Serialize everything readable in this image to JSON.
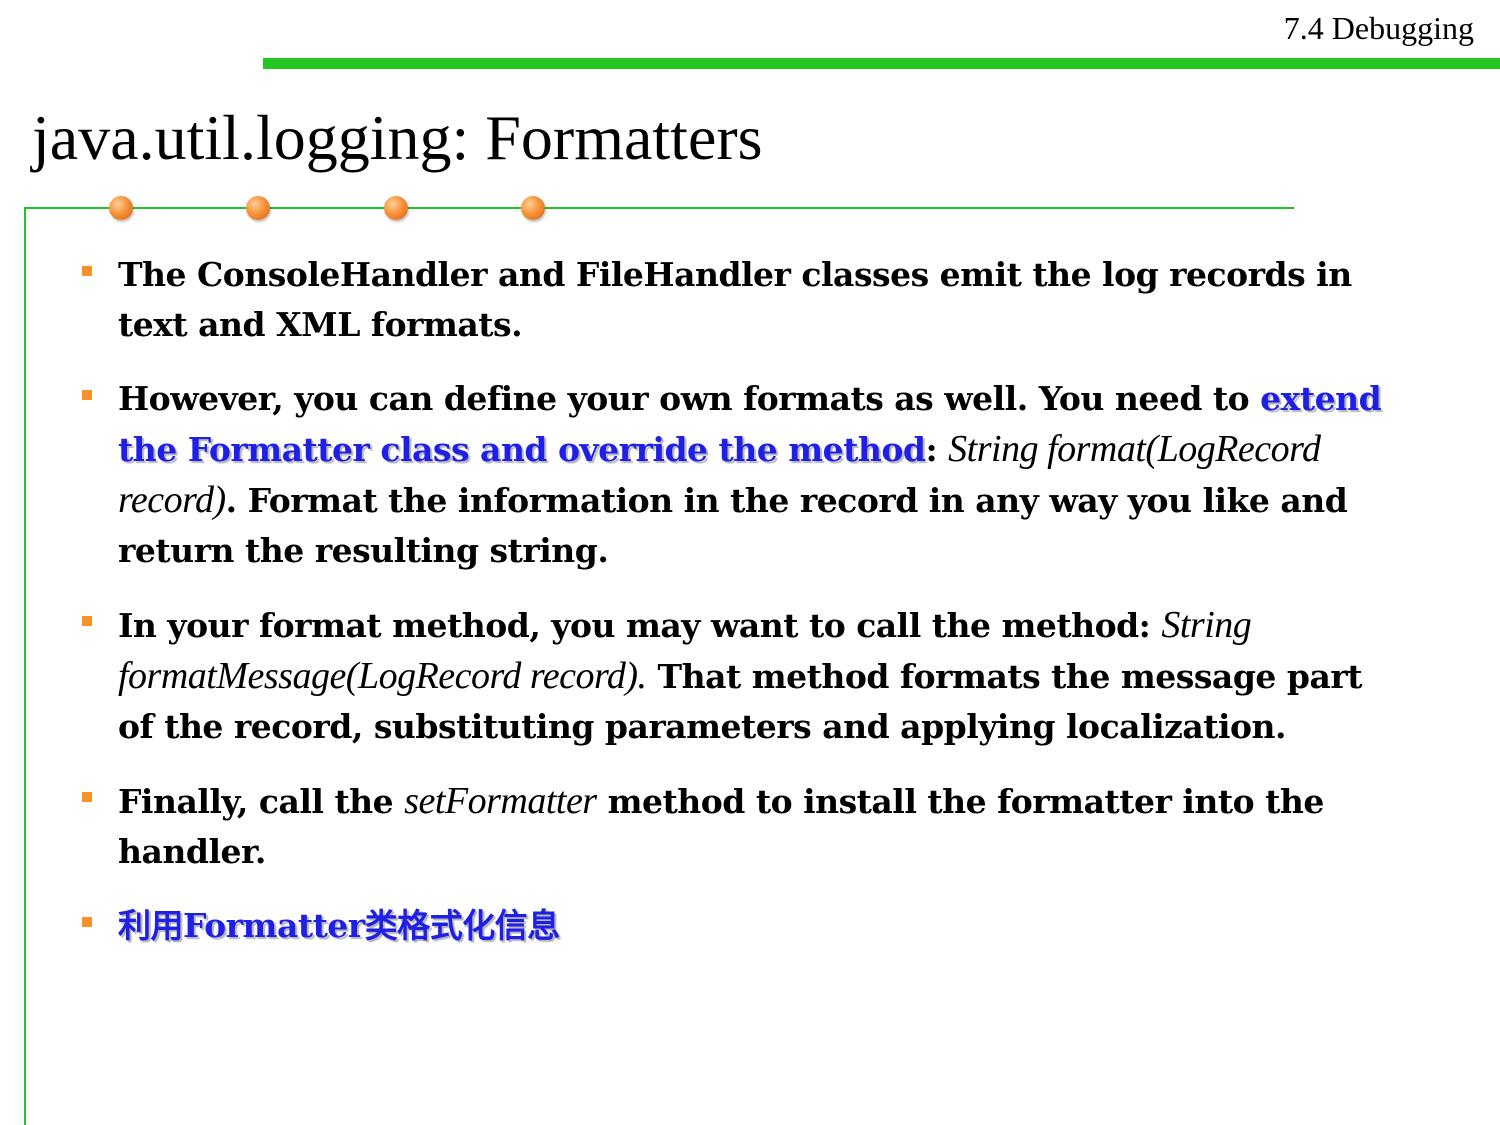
{
  "header": {
    "section_label": "7.4 Debugging"
  },
  "slide": {
    "title": "java.util.logging: Formatters"
  },
  "colors": {
    "accent_green": "#22c522",
    "bullet_orange": "#f7922a",
    "highlight_blue": "#1f1fe6"
  },
  "decor": {
    "icon": "orange-circle-dots"
  },
  "bullets": [
    {
      "t1": "The ConsoleHandler and FileHandler classes emit the log records in text and XML formats."
    },
    {
      "t1": "However, you can define your own formats as well. You need to ",
      "highlight": "extend the Formatter class and override the method",
      "t2": ":  ",
      "code": "String format(LogRecord record)",
      "t3": ". Format the information in the record in any way you like and return the resulting string."
    },
    {
      "t1": "In your format method, you may want to call the method:  ",
      "code": "String formatMessage(LogRecord record).",
      "t2": " That method formats the message part of the record, substituting parameters and applying localization."
    },
    {
      "t1": "Finally, call the ",
      "code": "setFormatter",
      "t2": " method to install the formatter into the handler."
    },
    {
      "highlight": "利用Formatter类格式化信息"
    }
  ]
}
